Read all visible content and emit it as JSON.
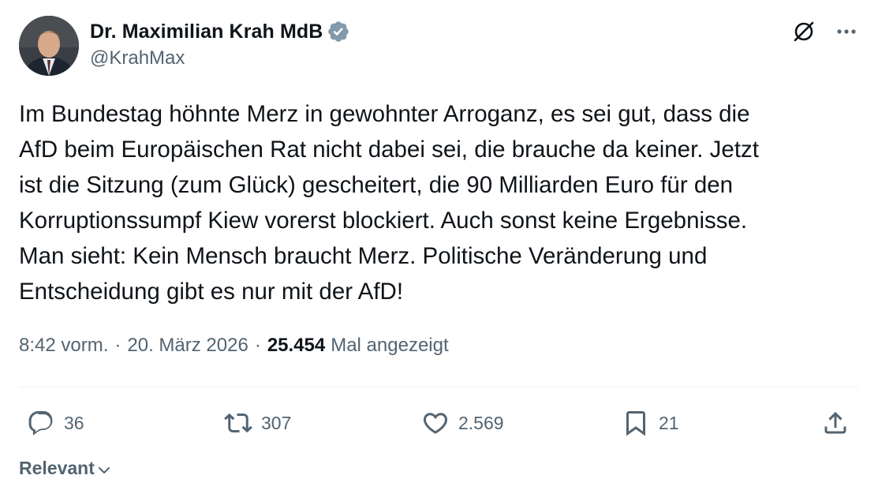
{
  "author": {
    "display_name": "Dr. Maximilian Krah MdB",
    "handle": "@KrahMax",
    "verified_color": "#829aab"
  },
  "header_icons": [
    "grok-icon",
    "more-icon"
  ],
  "tweet": {
    "text": "Im Bundestag höhnte Merz in gewohnter Arroganz, es sei gut, dass die\nAfD beim Europäischen Rat nicht dabei sei, die brauche da keiner. Jetzt\nist die Sitzung (zum Glück) gescheitert, die 90 Milliarden Euro für den\nKorruptionssumpf Kiew vorerst blockiert. Auch sonst keine Ergebnisse.\nMan sieht: Kein Mensch braucht Merz. Politische Veränderung und\nEntscheidung gibt es nur mit der AfD!",
    "time": "8:42 vorm.",
    "separator": "·",
    "date": "20. März 2026",
    "views_count": "25.454",
    "views_label": "Mal angezeigt"
  },
  "actions": {
    "replies": "36",
    "retweets": "307",
    "likes": "2.569",
    "bookmarks": "21"
  },
  "sort": {
    "label": "Relevant"
  },
  "colors": {
    "text_primary": "#0f1419",
    "text_secondary": "#536471",
    "divider": "#eff3f4"
  }
}
